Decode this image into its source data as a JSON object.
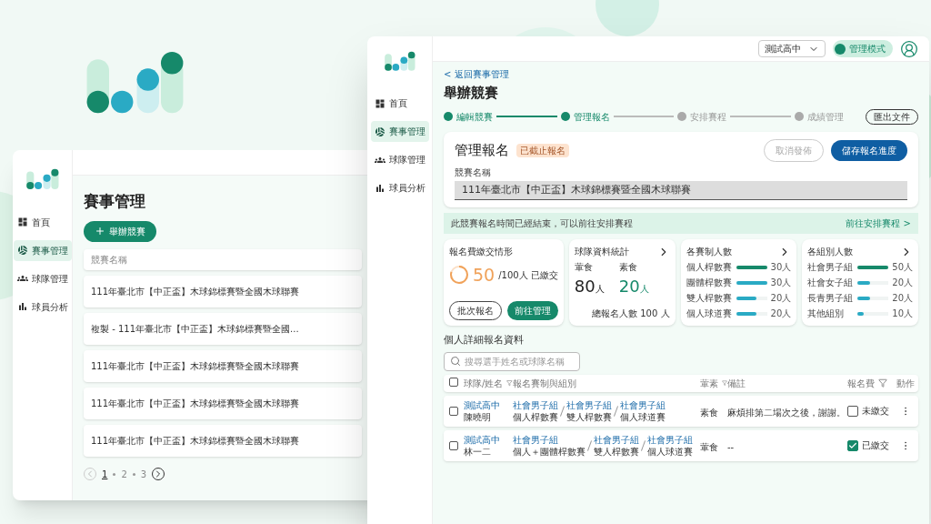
{
  "back_window": {
    "nav": [
      {
        "label": "首頁",
        "selected": false
      },
      {
        "label": "賽事管理",
        "selected": true
      },
      {
        "label": "球隊管理",
        "selected": false
      },
      {
        "label": "球員分析",
        "selected": false
      }
    ],
    "title": "賽事管理",
    "create_button": "舉辦競賽",
    "column": "競賽名稱",
    "rows": [
      "111年臺北市【中正盃】木球錦標賽暨全國木球聯賽",
      "複製 - 111年臺北市【中正盃】木球錦標賽暨全國...",
      "111年臺北市【中正盃】木球錦標賽暨全國木球聯賽",
      "111年臺北市【中正盃】木球錦標賽暨全國木球聯賽",
      "111年臺北市【中正盃】木球錦標賽暨全國木球聯賽"
    ],
    "pages": [
      {
        "label": "1",
        "selected": true
      },
      {
        "label": "2",
        "selected": false
      },
      {
        "label": "3",
        "selected": false
      }
    ]
  },
  "front_window": {
    "header": {
      "school_select": "測試高中",
      "mode_toggle": {
        "label": "管理模式",
        "on": true
      }
    },
    "nav": [
      {
        "label": "首頁",
        "selected": false
      },
      {
        "label": "賽事管理",
        "selected": true
      },
      {
        "label": "球隊管理",
        "selected": false
      },
      {
        "label": "球員分析",
        "selected": false
      }
    ],
    "back_link": "< 返回賽事管理",
    "title": "舉辦競賽",
    "steps": [
      {
        "label": "編輯競賽",
        "completed": true
      },
      {
        "label": "管理報名",
        "completed": true
      },
      {
        "label": "安排賽程",
        "completed": false
      },
      {
        "label": "成績管理",
        "completed": false
      }
    ],
    "export_button": "匯出文件",
    "panel": {
      "title": "管理報名",
      "badge": "已截止報名",
      "cancel_button": {
        "label": "取消發佈",
        "disabled": true
      },
      "save_button": "儲存報名進度",
      "field_label": "競賽名稱",
      "field_value": "111年臺北市【中正盃】木球錦標賽暨全國木球聯賽"
    },
    "banner": {
      "text": "此競賽報名時間已經結束，可以前往安排賽程",
      "link": "前往安排賽程 >"
    },
    "payment_card": {
      "title": "報名費繳交情形",
      "count": "50",
      "total": "/100人 已繳交",
      "buttons": [
        "批次報名",
        "前往管理"
      ]
    },
    "team_card": {
      "title": "球隊資料統計",
      "items": [
        {
          "label": "葷食",
          "value": "80",
          "unit": "人",
          "color": "#222222"
        },
        {
          "label": "素食",
          "value": "20",
          "unit": "人",
          "color": "#16896a"
        }
      ],
      "total": "總報名人數 100 人"
    },
    "bar_cards": [
      {
        "title": "各賽制人數",
        "bars": [
          {
            "label": "個人桿數賽",
            "level": 1,
            "reading": "30人",
            "color": "#16896a"
          },
          {
            "label": "團體桿數賽",
            "level": 1,
            "reading": "30人",
            "color": "#2aaac4"
          },
          {
            "label": "雙人桿數賽",
            "level": 0.67,
            "reading": "20人",
            "color": "#2aaac4"
          },
          {
            "label": "個人球道賽",
            "level": 0.67,
            "reading": "20人",
            "color": "#2aaac4"
          }
        ]
      },
      {
        "title": "各組別人數",
        "bars": [
          {
            "label": "社會男子組",
            "level": 1,
            "reading": "50人",
            "color": "#16896a"
          },
          {
            "label": "社會女子組",
            "level": 0.4,
            "reading": "20人",
            "color": "#2aaac4"
          },
          {
            "label": "長青男子組",
            "level": 0.4,
            "reading": "20人",
            "color": "#2aaac4"
          },
          {
            "label": "其他組別",
            "level": 0.2,
            "reading": "10人",
            "color": "#2aaac4"
          }
        ]
      }
    ],
    "section_title": "個人詳細報名資料",
    "search": {
      "placeholder": "搜尋選手姓名或球隊名稱"
    },
    "table": {
      "header_checked": false,
      "columns": [
        {
          "label": "球隊/姓名",
          "filter": true
        },
        {
          "label": "報名賽制與組別",
          "filter": false
        },
        {
          "label": "葷素",
          "filter": true
        },
        {
          "label": "備註",
          "filter": false
        },
        {
          "label": "報名費",
          "filter": true
        },
        {
          "label": "動作",
          "filter": false
        }
      ],
      "rows": [
        {
          "checked": false,
          "team": "測試高中",
          "name": "陳曉明",
          "events": [
            {
              "group": "社會男子組",
              "event": "個人桿數賽"
            },
            {
              "group": "社會男子組",
              "event": "雙人桿數賽"
            },
            {
              "group": "社會男子組",
              "event": "個人球道賽"
            }
          ],
          "diet": "素食",
          "note": "麻煩排第二場次之後，謝謝。",
          "fee": {
            "paid": false,
            "label": "未繳交"
          }
        },
        {
          "checked": false,
          "team": "測試高中",
          "name": "林一二",
          "events": [
            {
              "group": "社會男子組",
              "event": "個人＋團體桿數賽"
            },
            {
              "group": "社會男子組",
              "event": "雙人桿數賽"
            },
            {
              "group": "社會男子組",
              "event": "個人球道賽"
            }
          ],
          "diet": "葷食",
          "note": "--",
          "fee": {
            "paid": true,
            "label": "已繳交"
          }
        }
      ]
    }
  }
}
